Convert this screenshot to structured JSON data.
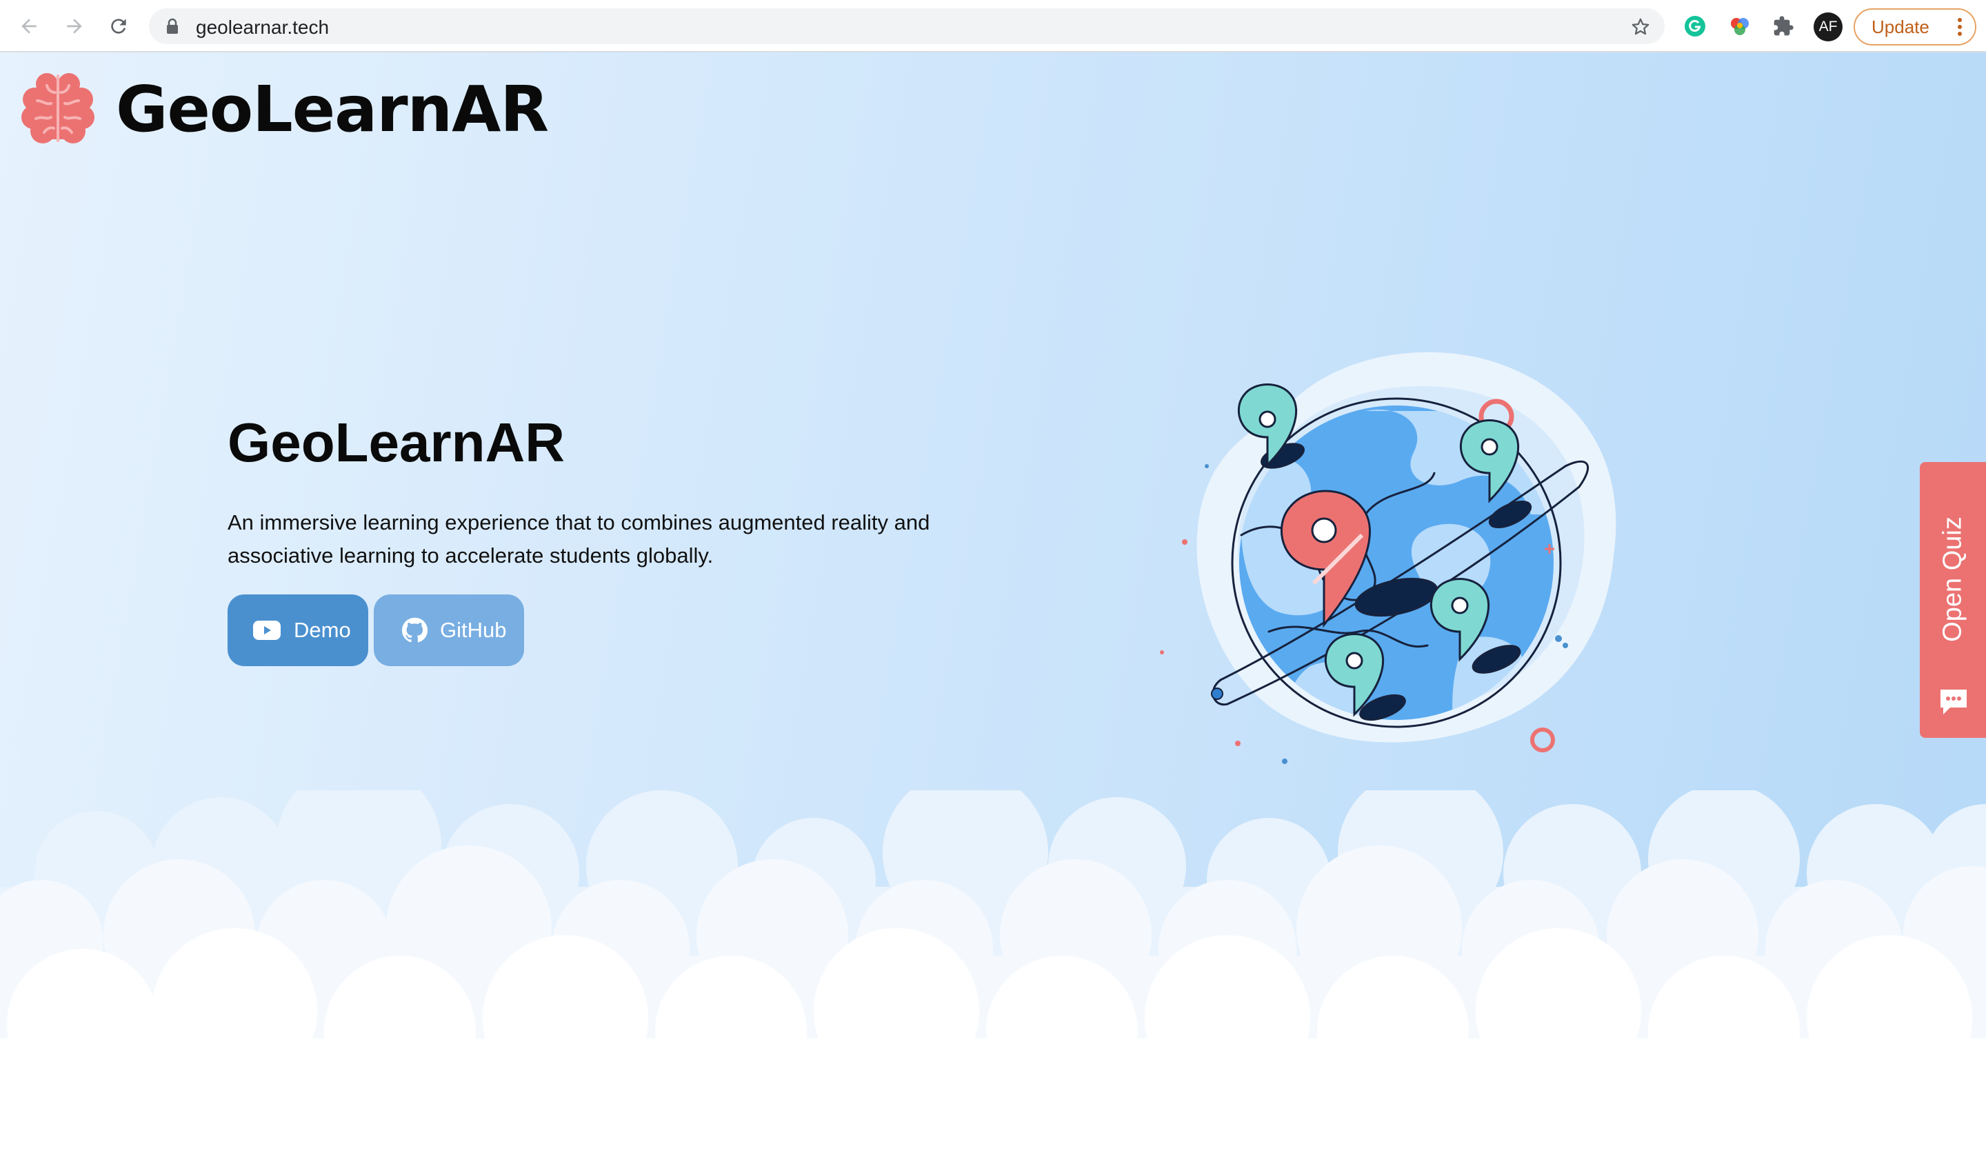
{
  "browser": {
    "url": "geolearnar.tech",
    "profile_initials": "AF",
    "update_label": "Update"
  },
  "site": {
    "brand_name": "GeoLearnAR",
    "brand_color": "#ec7272"
  },
  "hero": {
    "title": "GeoLearnAR",
    "description": "An immersive learning experience that to combines augmented reality and associative learning to accelerate students globally.",
    "buttons": [
      {
        "label": "Demo",
        "icon": "youtube-icon",
        "color": "#4a90cf"
      },
      {
        "label": "GitHub",
        "icon": "github-icon",
        "color": "#78aee2"
      }
    ]
  },
  "side_tab": {
    "label": "Open Quiz",
    "icon": "chat-bubble-icon",
    "color": "#ec7272"
  }
}
